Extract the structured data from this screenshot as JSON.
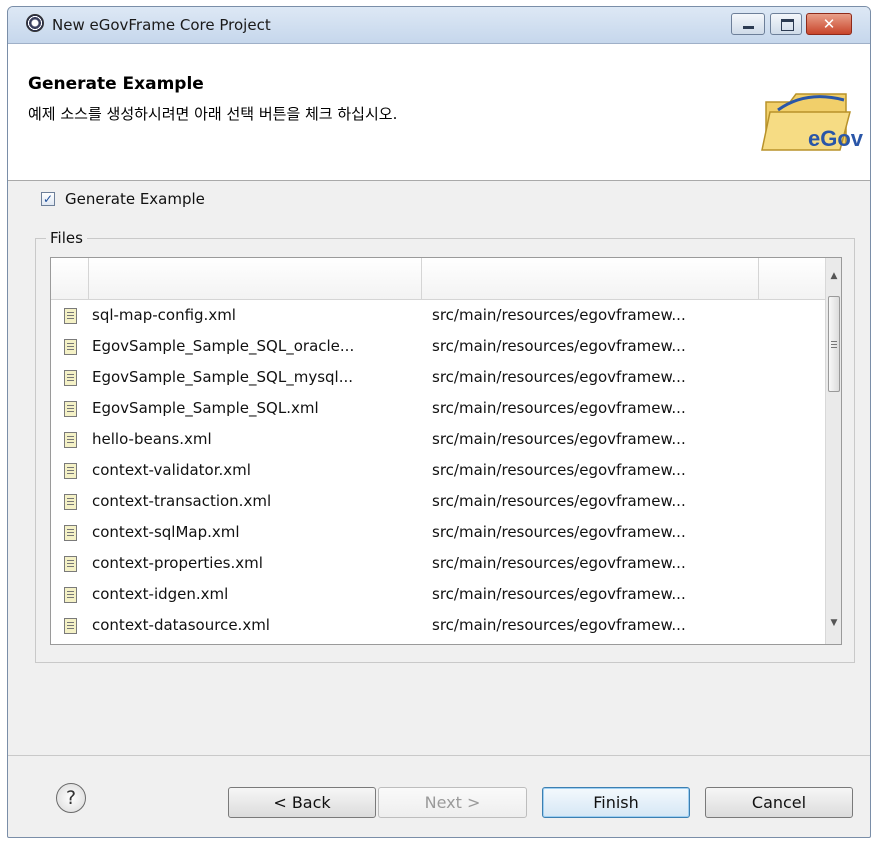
{
  "window": {
    "title": "New eGovFrame Core Project",
    "close_glyph": "✕"
  },
  "header": {
    "title": "Generate Example",
    "description": "예제 소스를 생성하시려면 아래 선택 버튼을 체크 하십시오.",
    "logo_text": "eGov"
  },
  "options": {
    "generate_example_label": "Generate Example",
    "generate_example_checked": true,
    "check_glyph": "✓"
  },
  "files": {
    "group_label": "Files",
    "columns": [
      "",
      "",
      ""
    ],
    "rows": [
      {
        "name": "sql-map-config.xml",
        "path": "src/main/resources/egovframew..."
      },
      {
        "name": "EgovSample_Sample_SQL_oracle...",
        "path": "src/main/resources/egovframew..."
      },
      {
        "name": "EgovSample_Sample_SQL_mysql...",
        "path": "src/main/resources/egovframew..."
      },
      {
        "name": "EgovSample_Sample_SQL.xml",
        "path": "src/main/resources/egovframew..."
      },
      {
        "name": "hello-beans.xml",
        "path": "src/main/resources/egovframew..."
      },
      {
        "name": "context-validator.xml",
        "path": "src/main/resources/egovframew..."
      },
      {
        "name": "context-transaction.xml",
        "path": "src/main/resources/egovframew..."
      },
      {
        "name": "context-sqlMap.xml",
        "path": "src/main/resources/egovframew..."
      },
      {
        "name": "context-properties.xml",
        "path": "src/main/resources/egovframew..."
      },
      {
        "name": "context-idgen.xml",
        "path": "src/main/resources/egovframew..."
      },
      {
        "name": "context-datasource.xml",
        "path": "src/main/resources/egovframew..."
      }
    ],
    "row_icon": "xml-file-icon",
    "scroll_up_glyph": "▲",
    "scroll_down_glyph": "▼"
  },
  "footer": {
    "help_glyph": "?",
    "back_label": "< Back",
    "next_label": "Next >",
    "finish_label": "Finish",
    "cancel_label": "Cancel"
  }
}
